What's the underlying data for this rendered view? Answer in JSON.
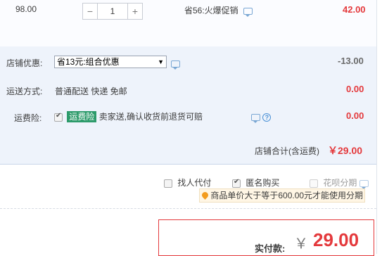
{
  "item": {
    "price": "98.00",
    "quantity": "1",
    "minus_label": "−",
    "plus_label": "+",
    "promo_text": "省56:火爆促销",
    "subtotal": "42.00"
  },
  "shop": {
    "discount_label": "店铺优惠:",
    "discount_select_value": "省13元:组合优惠",
    "discount_value": "-13.00",
    "shipping_label": "运送方式:",
    "shipping_text": "普通配送 快递 免邮",
    "shipping_value": "0.00",
    "insurance_label": "运费险:",
    "insurance_badge": "运费险",
    "insurance_text": "卖家送,确认收货前退货可赔",
    "insurance_value": "0.00",
    "total_label": "店铺合计(含运费)",
    "total_value": "￥29.00",
    "help_glyph": "?"
  },
  "options": {
    "proxy_pay": "找人代付",
    "anonymous": "匿名购买",
    "installment": "花呗分期",
    "tip": "商品单价大于等于600.00元才能使用分期"
  },
  "payment": {
    "label": "实付款:",
    "currency": "￥",
    "amount": "29.00"
  },
  "colors": {
    "accent_red": "#e4393c",
    "section_bg": "#eef3fb",
    "badge_green": "#2d9b6b"
  },
  "icons": {
    "chat": "chat-bubble-icon",
    "help": "question-circle-icon",
    "tip": "location-pin-icon"
  }
}
